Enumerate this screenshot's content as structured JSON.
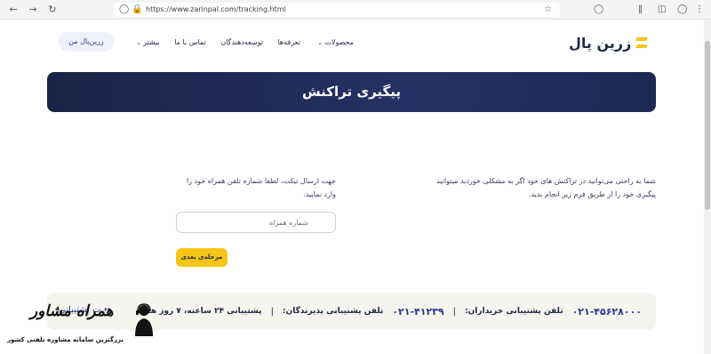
{
  "browser": {
    "url": "https://www.zarinpal.com/tracking.html"
  },
  "header": {
    "logo_text": "زرین پال",
    "nav": [
      {
        "label": "محصولات",
        "has_dropdown": true
      },
      {
        "label": "تعرفه‌ها",
        "has_dropdown": false
      },
      {
        "label": "توسعه‌دهندگان",
        "has_dropdown": false
      },
      {
        "label": "تماس با ما",
        "has_dropdown": false
      },
      {
        "label": "بیشتر",
        "has_dropdown": true
      }
    ],
    "login_label": "زرین‌پال من"
  },
  "hero": {
    "title": "پیگیری تراکنش"
  },
  "main": {
    "description": "شما به راحتی می‌توانید در تراکنش های خود اگر به مشکلی خوردید میتوانید پیگیری خود را از طریق فرم زیر انجام بدید.",
    "form_note": "جهت ارسال تیکت، لطفا شماره تلفن همراه خود را وارد نمایید.",
    "phone_placeholder": "شماره همراه",
    "next_label": "مرحله‌ی بعدی"
  },
  "support": {
    "hours": "پشتیبانی ۲۴ ساعته، ۷ روز هفته",
    "merchant_label": "تلفن پشتیبانی پذیرندگان:",
    "merchant_phone": "۰۲۱-۴۱۲۳۹",
    "buyer_label": "تلفن پشتیبانی خریداران:",
    "buyer_phone": "۰۲۱-۴۵۶۲۸۰۰۰",
    "support_link": "ت پشتیبانی"
  },
  "watermark": {
    "title": "همراه مشاور",
    "subtitle": "بزرگترین سامانه مشاوره تلفنی کشور"
  },
  "colors": {
    "hero_bg": "#1e2a55",
    "accent": "#f5c518",
    "phone": "#2a3b8f"
  }
}
